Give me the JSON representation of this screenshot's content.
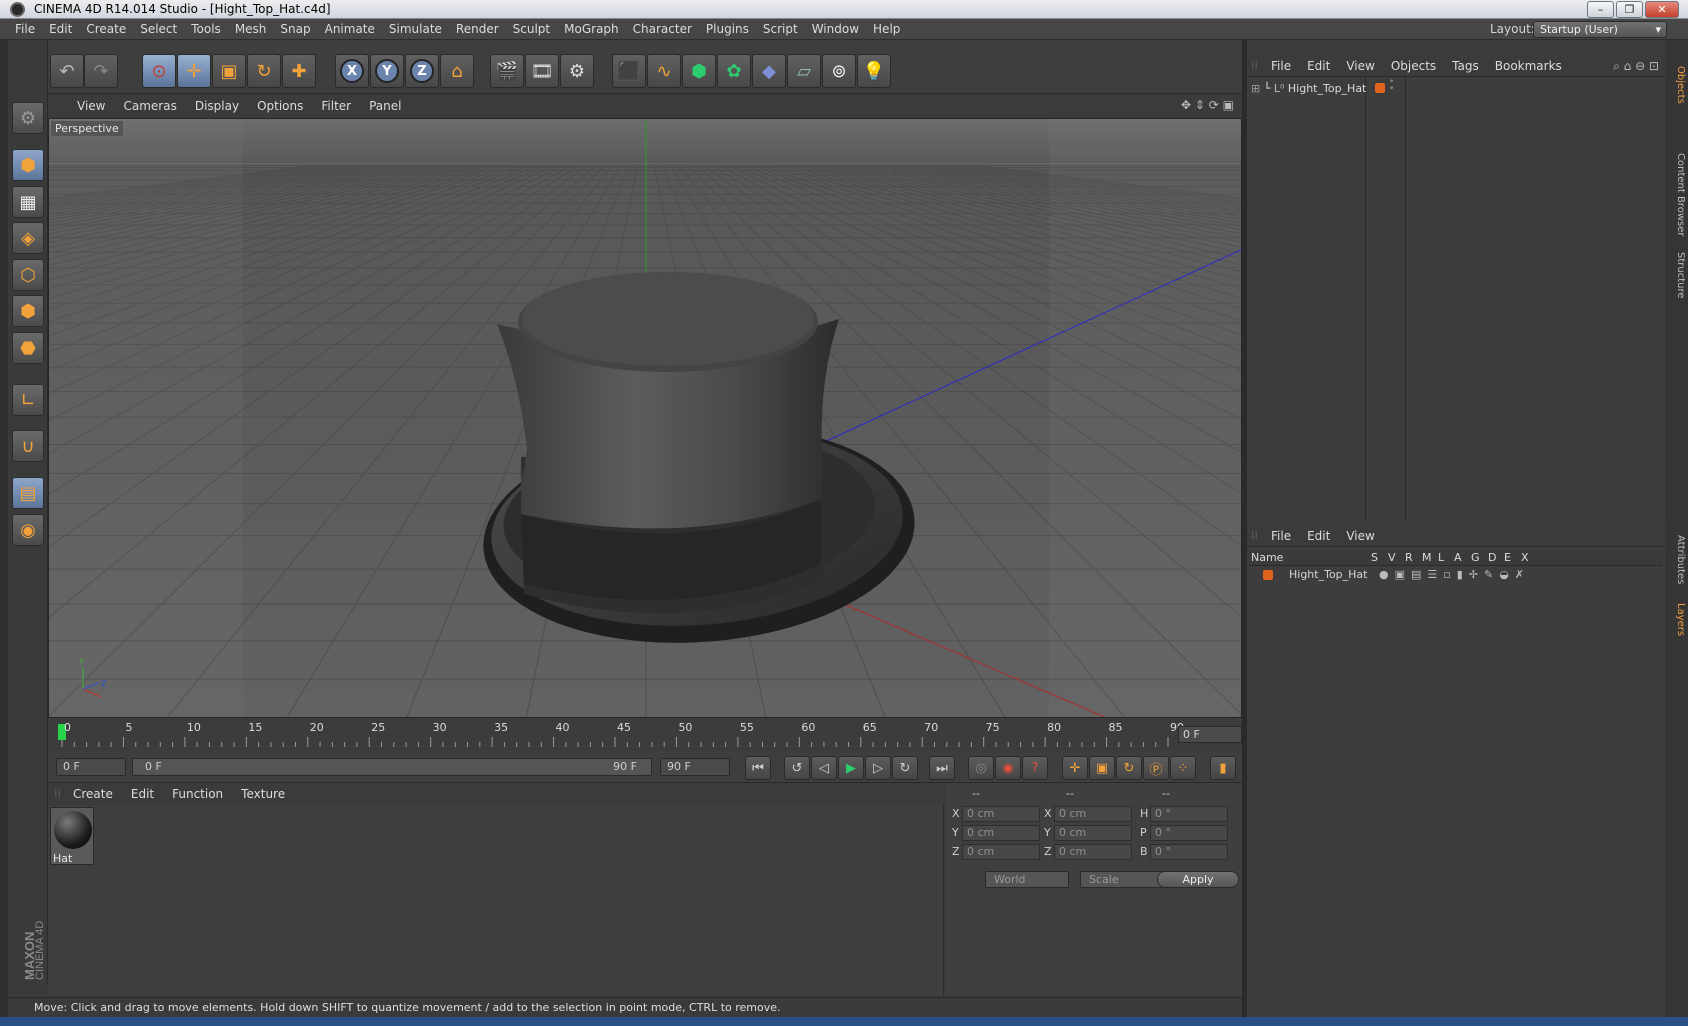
{
  "window": {
    "title": "CINEMA 4D R14.014 Studio - [Hight_Top_Hat.c4d]",
    "minimize": "–",
    "maximize": "❐",
    "close": "✕"
  },
  "menubar": {
    "items": [
      "File",
      "Edit",
      "Create",
      "Select",
      "Tools",
      "Mesh",
      "Snap",
      "Animate",
      "Simulate",
      "Render",
      "Sculpt",
      "MoGraph",
      "Character",
      "Plugins",
      "Script",
      "Window",
      "Help"
    ],
    "layout_label": "Layout:",
    "layout_value": "Startup (User)"
  },
  "viewport": {
    "menu": [
      "View",
      "Cameras",
      "Display",
      "Options",
      "Filter",
      "Panel"
    ],
    "label": "Perspective"
  },
  "timeline": {
    "ticks": [
      "0",
      "5",
      "10",
      "15",
      "20",
      "25",
      "30",
      "35",
      "40",
      "45",
      "50",
      "55",
      "60",
      "65",
      "70",
      "75",
      "80",
      "85",
      "90"
    ],
    "current_frame": "0 F"
  },
  "playback": {
    "start_field": "0 F",
    "range_start": "0 F",
    "range_end": "90 F",
    "end_field": "90 F"
  },
  "materials": {
    "menu": [
      "Create",
      "Edit",
      "Function",
      "Texture"
    ],
    "items": [
      {
        "name": "Hat"
      }
    ]
  },
  "coordinates": {
    "headers": [
      "--",
      "--",
      "--"
    ],
    "rows": [
      {
        "l1": "X",
        "v1": "0 cm",
        "l2": "X",
        "v2": "0 cm",
        "l3": "H",
        "v3": "0 °"
      },
      {
        "l1": "Y",
        "v1": "0 cm",
        "l2": "Y",
        "v2": "0 cm",
        "l3": "P",
        "v3": "0 °"
      },
      {
        "l1": "Z",
        "v1": "0 cm",
        "l2": "Z",
        "v2": "0 cm",
        "l3": "B",
        "v3": "0 °"
      }
    ],
    "mode": "World",
    "transform": "Scale",
    "apply": "Apply"
  },
  "status": "Move: Click and drag to move elements. Hold down SHIFT to quantize movement / add to the selection in point mode, CTRL to remove.",
  "objects": {
    "menu": [
      "File",
      "Edit",
      "View",
      "Objects",
      "Tags",
      "Bookmarks"
    ],
    "items": [
      {
        "name": "Hight_Top_Hat"
      }
    ]
  },
  "layers": {
    "menu": [
      "File",
      "Edit",
      "View"
    ],
    "columns": [
      "Name",
      "S",
      "V",
      "R",
      "M",
      "L",
      "A",
      "G",
      "D",
      "E",
      "X"
    ],
    "items": [
      {
        "name": "Hight_Top_Hat"
      }
    ]
  },
  "right_tabs": [
    "Objects",
    "Content Browser",
    "Structure",
    "Attributes",
    "Layers"
  ],
  "brand": {
    "line1": "MAXON",
    "line2": "CINEMA 4D"
  },
  "colors": {
    "accent": "#f2a23a",
    "object_color": "#e0641e",
    "active_tool": "#6b84ad"
  }
}
